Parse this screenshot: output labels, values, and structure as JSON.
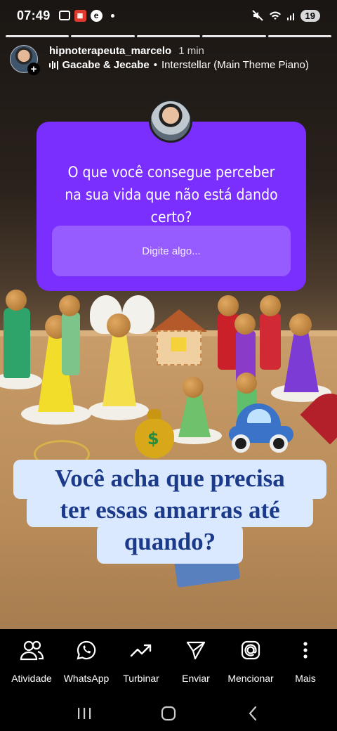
{
  "status_bar": {
    "time": "07:49",
    "left_icons": [
      "screen-record-icon",
      "app-notification-icon",
      "e-app-icon",
      "more-dot"
    ],
    "right_icons": [
      "mute-icon",
      "wifi-icon",
      "signal-icon"
    ],
    "battery": "19"
  },
  "story": {
    "progress_segments": 5,
    "username": "hipnoterapeuta_marcelo",
    "time_ago": "1 min",
    "music_artist": "Gacabe & Jecabe",
    "music_separator": "•",
    "music_title": "Interstellar (Main Theme Piano)"
  },
  "question_sticker": {
    "question": "O que você consegue perceber na sua vida que não está dando certo?",
    "placeholder": "Digite algo...",
    "color": "#7a2fff"
  },
  "caption": {
    "line1": "Você acha que precisa",
    "line2": "ter essas amarras até",
    "line3": "quando?",
    "text_color": "#1c3a8a",
    "background": "#dbe9ff"
  },
  "actions": [
    {
      "label": "Atividade",
      "icon": "people-icon"
    },
    {
      "label": "WhatsApp",
      "icon": "whatsapp-icon"
    },
    {
      "label": "Turbinar",
      "icon": "trending-up-icon"
    },
    {
      "label": "Enviar",
      "icon": "send-icon"
    },
    {
      "label": "Mencionar",
      "icon": "at-icon"
    },
    {
      "label": "Mais",
      "icon": "more-vertical-icon"
    }
  ],
  "android_nav": [
    "recents-icon",
    "home-icon",
    "back-icon"
  ]
}
